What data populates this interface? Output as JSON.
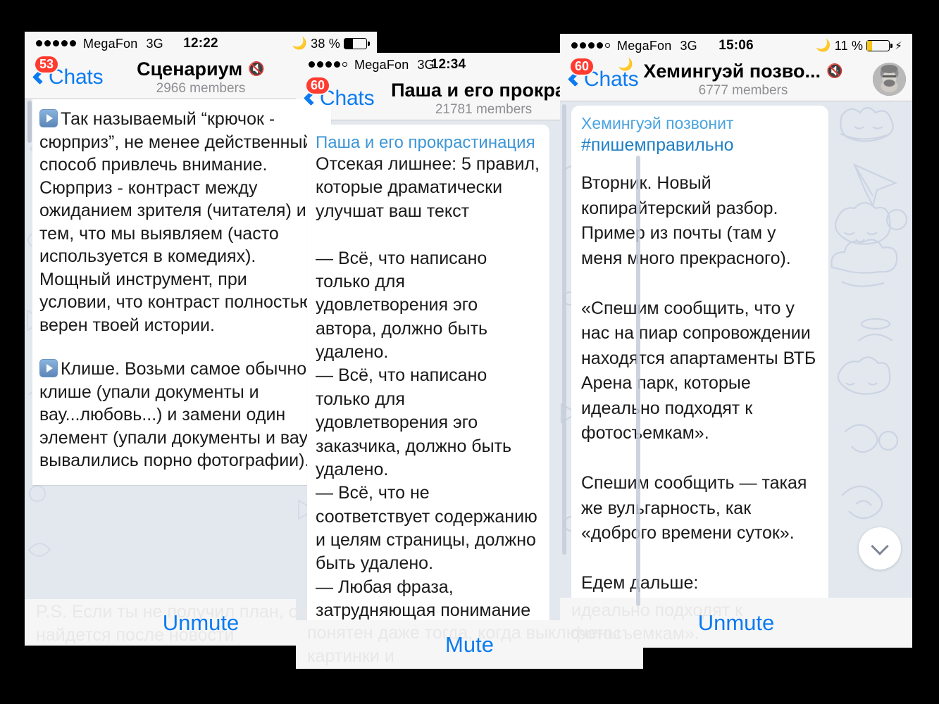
{
  "panels": [
    {
      "id": "scenarium",
      "status": {
        "carrier": "MegaFon",
        "network": "3G",
        "time": "12:22",
        "battery_pct": "38 %",
        "signal_filled": 5,
        "signal_total": 5,
        "moon_icon": "moon-icon",
        "charging": false
      },
      "nav": {
        "back_label": "Chats",
        "badge": "53",
        "title": "Сценариум",
        "subtitle": "2966 members",
        "mute_icon": "muted-speaker-icon"
      },
      "messages": [
        {
          "has_play_icon": true,
          "text": "Так называемый “крючок - сюрприз”, не менее действенный способ привлечь внимание. Сюрприз - контраст между ожиданием зрителя (читателя) и тем, что мы выявляем (часто используется в комедиях). Мощный инструмент, при условии, что контраст полностью верен твоей истории."
        },
        {
          "has_play_icon": true,
          "text": "Клише. Возьми самое обычное клише (упали документы и вау...любовь...) и замени один элемент (упали документы и вау... вывалились порно фотографии)."
        }
      ],
      "action": {
        "label": "Unmute",
        "ghost_text": "P.S. Если ты не получил план, он найдется после новости"
      }
    },
    {
      "id": "pasha",
      "status": {
        "carrier": "MegaFon",
        "network": "3G",
        "time": "12:34",
        "battery_pct": "",
        "signal_filled": 4,
        "signal_total": 5,
        "moon_icon": "moon-icon",
        "charging": false
      },
      "nav": {
        "back_label": "Chats",
        "badge": "60",
        "title": "Паша и его прокрас",
        "subtitle": "21781 members",
        "mute_icon": ""
      },
      "messages": [
        {
          "channel_title": "Паша и его прокрастинация",
          "has_play_icon": false,
          "text": "Отсекая лишнее: 5 правил, которые драматически улучшат ваш текст\n\n— Всё, что написано только для удовлетворения эго автора, должно быть удалено.\n— Всё, что написано только для удовлетворения эго заказчика, должно быть удалено.\n— Всё, что не соответствует содержанию и целям страницы, должно быть удалено.\n— Любая фраза, затрудняющая понимание текста, должна быть исправлена или удалена.\n— Текст должен быть"
        }
      ],
      "action": {
        "label": "Mute",
        "ghost_text": "понятен даже тогда, когда выключены картинки и"
      }
    },
    {
      "id": "hemingway",
      "status": {
        "carrier": "MegaFon",
        "network": "3G",
        "time": "15:06",
        "battery_pct": "11 %",
        "signal_filled": 4,
        "signal_total": 5,
        "moon_icon": "moon-icon",
        "charging": true
      },
      "nav": {
        "back_label": "Chats",
        "badge": "60",
        "title": "Хемингуэй позво...",
        "subtitle": "6777 members",
        "mute_icon": "muted-speaker-icon",
        "avatar": "hemingway-portrait"
      },
      "messages": [
        {
          "channel_title": "Хемингуэй позвонит",
          "hashtag": "#пишемправильно",
          "has_play_icon": false,
          "text": "Вторник. Новый копирайтерский разбор. Пример из почты (там у меня много прекрасного).\n\n«Спешим сообщить, что у нас на пиар сопровождении находятся апартаменты ВТБ Арена парк, которые идеально подходят к фотосъемкам».\n\nСпешим сообщить — такая же вульгарность, как «доброго времени суток».\n\nЕдем дальше:"
        }
      ],
      "action": {
        "label": "Unmute",
        "ghost_text": "идеально подходят к\nфотосъемкам»."
      },
      "scroll_down_icon": "chevron-down-icon"
    }
  ],
  "colors": {
    "accent_blue": "#0b7bf1",
    "badge_red": "#ff3b30",
    "channel_title_blue": "#4aa3e0",
    "chat_bg": "#e3e8ef",
    "bar_bg": "#f7f7f7"
  }
}
